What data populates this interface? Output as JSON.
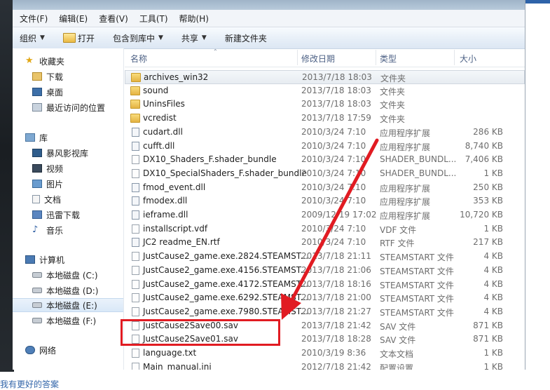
{
  "menubar": [
    "文件(F)",
    "编辑(E)",
    "查看(V)",
    "工具(T)",
    "帮助(H)"
  ],
  "toolbar": {
    "organize": "组织",
    "open": "打开",
    "include": "包含到库中",
    "share": "共享",
    "new_folder": "新建文件夹"
  },
  "nav": {
    "favorites": "收藏夹",
    "downloads": "下载",
    "desktop": "桌面",
    "recent": "最近访问的位置",
    "libraries": "库",
    "storm": "暴风影视库",
    "videos": "视频",
    "pictures": "图片",
    "documents": "文档",
    "thunder": "迅雷下载",
    "music": "音乐",
    "computer": "计算机",
    "disk_c": "本地磁盘 (C:)",
    "disk_d": "本地磁盘 (D:)",
    "disk_e": "本地磁盘 (E:)",
    "disk_f": "本地磁盘 (F:)",
    "network": "网络"
  },
  "columns": {
    "name": "名称",
    "date": "修改日期",
    "type": "类型",
    "size": "大小"
  },
  "files": [
    {
      "name": "archives_win32",
      "date": "2013/7/18 18:03",
      "type": "文件夹",
      "size": "",
      "icon": "folder"
    },
    {
      "name": "sound",
      "date": "2013/7/18 18:03",
      "type": "文件夹",
      "size": "",
      "icon": "folder"
    },
    {
      "name": "UninsFiles",
      "date": "2013/7/18 18:03",
      "type": "文件夹",
      "size": "",
      "icon": "folder"
    },
    {
      "name": "vcredist",
      "date": "2013/7/18 17:59",
      "type": "文件夹",
      "size": "",
      "icon": "folder"
    },
    {
      "name": "cudart.dll",
      "date": "2010/3/24 7:10",
      "type": "应用程序扩展",
      "size": "286 KB",
      "icon": "dll"
    },
    {
      "name": "cufft.dll",
      "date": "2010/3/24 7:10",
      "type": "应用程序扩展",
      "size": "8,740 KB",
      "icon": "dll"
    },
    {
      "name": "DX10_Shaders_F.shader_bundle",
      "date": "2010/3/24 7:10",
      "type": "SHADER_BUNDL...",
      "size": "7,406 KB",
      "icon": "file"
    },
    {
      "name": "DX10_SpecialShaders_F.shader_bundle",
      "date": "2010/3/24 7:10",
      "type": "SHADER_BUNDL...",
      "size": "1 KB",
      "icon": "file"
    },
    {
      "name": "fmod_event.dll",
      "date": "2010/3/24 7:10",
      "type": "应用程序扩展",
      "size": "250 KB",
      "icon": "dll"
    },
    {
      "name": "fmodex.dll",
      "date": "2010/3/24 7:10",
      "type": "应用程序扩展",
      "size": "353 KB",
      "icon": "dll"
    },
    {
      "name": "ieframe.dll",
      "date": "2009/12/19 17:02",
      "type": "应用程序扩展",
      "size": "10,720 KB",
      "icon": "dll"
    },
    {
      "name": "installscript.vdf",
      "date": "2010/3/24 7:10",
      "type": "VDF 文件",
      "size": "1 KB",
      "icon": "file"
    },
    {
      "name": "JC2 readme_EN.rtf",
      "date": "2010/3/24 7:10",
      "type": "RTF 文件",
      "size": "217 KB",
      "icon": "dll"
    },
    {
      "name": "JustCause2_game.exe.2824.STEAMST...",
      "date": "2013/7/18 21:11",
      "type": "STEAMSTART 文件",
      "size": "4 KB",
      "icon": "file"
    },
    {
      "name": "JustCause2_game.exe.4156.STEAMST...",
      "date": "2013/7/18 21:06",
      "type": "STEAMSTART 文件",
      "size": "4 KB",
      "icon": "file"
    },
    {
      "name": "JustCause2_game.exe.4172.STEAMST...",
      "date": "2013/7/18 18:16",
      "type": "STEAMSTART 文件",
      "size": "4 KB",
      "icon": "file"
    },
    {
      "name": "JustCause2_game.exe.6292.STEAMST...",
      "date": "2013/7/18 21:00",
      "type": "STEAMSTART 文件",
      "size": "4 KB",
      "icon": "file"
    },
    {
      "name": "JustCause2_game.exe.7980.STEAMST...",
      "date": "2013/7/18 21:27",
      "type": "STEAMSTART 文件",
      "size": "4 KB",
      "icon": "file"
    },
    {
      "name": "JustCause2Save00.sav",
      "date": "2013/7/18 21:42",
      "type": "SAV 文件",
      "size": "871 KB",
      "icon": "file"
    },
    {
      "name": "JustCause2Save01.sav",
      "date": "2013/7/18 18:28",
      "type": "SAV 文件",
      "size": "871 KB",
      "icon": "file"
    },
    {
      "name": "language.txt",
      "date": "2010/3/19 8:36",
      "type": "文本文档",
      "size": "1 KB",
      "icon": "file"
    },
    {
      "name": "Main_manual.ini",
      "date": "2012/7/18 21:42",
      "type": "配置设置",
      "size": "1 KB",
      "icon": "file"
    }
  ],
  "bottom_text": "我有更好的答案",
  "colors": {
    "annotation": "#e11b22",
    "folder": "#e4b343",
    "column_header": "#4d6185"
  }
}
